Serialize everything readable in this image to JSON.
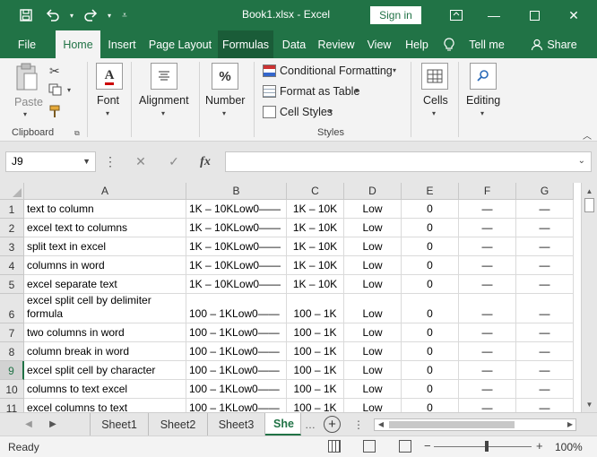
{
  "titlebar": {
    "document_title": "Book1.xlsx  -  Excel",
    "signin_label": "Sign in",
    "qat_icons": [
      "save-icon",
      "undo-icon",
      "redo-icon",
      "customize-icon"
    ]
  },
  "tabs": [
    "File",
    "Home",
    "Insert",
    "Page Layout",
    "Formulas",
    "Data",
    "Review",
    "View",
    "Help",
    "Tell me",
    "Share"
  ],
  "active_tab": "Home",
  "ribbon": {
    "clipboard": {
      "paste_label": "Paste",
      "group_label": "Clipboard"
    },
    "font": {
      "label": "Font"
    },
    "alignment": {
      "label": "Alignment"
    },
    "number": {
      "label": "Number"
    },
    "styles": {
      "conditional": "Conditional Formatting",
      "format_table": "Format as Table",
      "cell_styles": "Cell Styles",
      "group_label": "Styles"
    },
    "cells": {
      "label": "Cells"
    },
    "editing": {
      "label": "Editing"
    }
  },
  "formula_bar": {
    "name_box": "J9",
    "fx_label": "fx",
    "value": ""
  },
  "grid": {
    "columns": [
      "A",
      "B",
      "C",
      "D",
      "E",
      "F",
      "G"
    ],
    "selected_row": "9",
    "rows": [
      {
        "num": "1",
        "a": "text to column",
        "b": "1K – 10KLow0——",
        "c": "1K – 10K",
        "d": "Low",
        "e": "0",
        "f": "—",
        "g": "—"
      },
      {
        "num": "2",
        "a": "excel text to columns",
        "b": "1K – 10KLow0——",
        "c": "1K – 10K",
        "d": "Low",
        "e": "0",
        "f": "—",
        "g": "—"
      },
      {
        "num": "3",
        "a": "split text in excel",
        "b": "1K – 10KLow0——",
        "c": "1K – 10K",
        "d": "Low",
        "e": "0",
        "f": "—",
        "g": "—"
      },
      {
        "num": "4",
        "a": "columns in word",
        "b": "1K – 10KLow0——",
        "c": "1K – 10K",
        "d": "Low",
        "e": "0",
        "f": "—",
        "g": "—"
      },
      {
        "num": "5",
        "a": "excel separate text",
        "b": "1K – 10KLow0——",
        "c": "1K – 10K",
        "d": "Low",
        "e": "0",
        "f": "—",
        "g": "—"
      },
      {
        "num": "6",
        "a": "excel split cell by delimiter formula",
        "b": "100 – 1KLow0——",
        "c": "100 – 1K",
        "d": "Low",
        "e": "0",
        "f": "—",
        "g": "—"
      },
      {
        "num": "7",
        "a": "two columns in word",
        "b": "100 – 1KLow0——",
        "c": "100 – 1K",
        "d": "Low",
        "e": "0",
        "f": "—",
        "g": "—"
      },
      {
        "num": "8",
        "a": "column break in word",
        "b": "100 – 1KLow0——",
        "c": "100 – 1K",
        "d": "Low",
        "e": "0",
        "f": "—",
        "g": "—"
      },
      {
        "num": "9",
        "a": "excel split cell by character",
        "b": "100 – 1KLow0——",
        "c": "100 – 1K",
        "d": "Low",
        "e": "0",
        "f": "—",
        "g": "—"
      },
      {
        "num": "10",
        "a": "columns to text excel",
        "b": "100 – 1KLow0——",
        "c": "100 – 1K",
        "d": "Low",
        "e": "0",
        "f": "—",
        "g": "—"
      },
      {
        "num": "11",
        "a": "excel columns to text",
        "b": "100 – 1KLow0——",
        "c": "100 – 1K",
        "d": "Low",
        "e": "0",
        "f": "—",
        "g": "—"
      }
    ]
  },
  "sheets": [
    "Sheet1",
    "Sheet2",
    "Sheet3",
    "She"
  ],
  "active_sheet": "She",
  "statusbar": {
    "status": "Ready",
    "zoom": "100%",
    "zoom_minus": "−",
    "zoom_plus": "+"
  },
  "colors": {
    "accent": "#217346",
    "ribbon_bg": "#f3f3f3",
    "header_bg": "#e6e6e6"
  }
}
